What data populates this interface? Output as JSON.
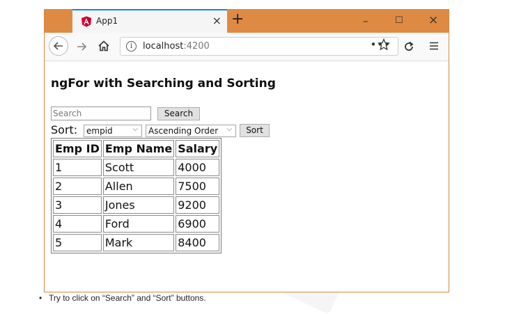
{
  "browser": {
    "tab_title": "App1",
    "tab_close": "×",
    "new_tab": "+",
    "window_controls": {
      "minimize": "–",
      "maximize": "☐",
      "close": "×"
    },
    "url": {
      "host": "localhost",
      "port": ":4200"
    },
    "page_actions": "•••",
    "icons": [
      "angular-logo-icon",
      "back-arrow-icon",
      "forward-arrow-icon",
      "home-icon",
      "info-icon",
      "bookmark-star-icon",
      "reload-icon",
      "menu-icon"
    ],
    "colors": {
      "titlebar": "#de8a43",
      "tab_accent": "#0a84ff",
      "angular_red": "#dd0031"
    }
  },
  "page": {
    "title": "ngFor with Searching and Sorting",
    "search": {
      "placeholder": "Search",
      "value": "",
      "button": "Search"
    },
    "sort": {
      "label": "Sort:",
      "field_selected": "empid",
      "order_selected": "Ascending Order",
      "button": "Sort"
    },
    "table": {
      "headers": [
        "Emp ID",
        "Emp Name",
        "Salary"
      ],
      "rows": [
        [
          "1",
          "Scott",
          "4000"
        ],
        [
          "2",
          "Allen",
          "7500"
        ],
        [
          "3",
          "Jones",
          "9200"
        ],
        [
          "4",
          "Ford",
          "6900"
        ],
        [
          "5",
          "Mark",
          "8400"
        ]
      ]
    }
  },
  "note": {
    "bullet": "•",
    "text": "Try to click on “Search” and “Sort” buttons."
  }
}
